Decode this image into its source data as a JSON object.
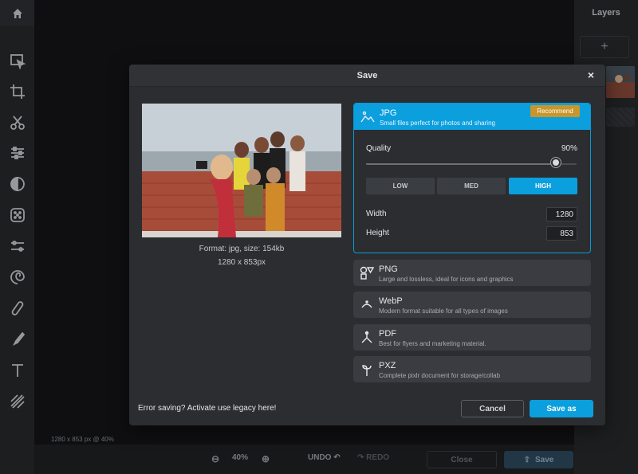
{
  "layers": {
    "title": "Layers",
    "add_label": "+"
  },
  "canvas": {
    "info": "1280 x 853 px @ 40%"
  },
  "bottombar": {
    "zoom": "40%",
    "undo": "UNDO",
    "redo": "REDO",
    "close": "Close",
    "save": "Save"
  },
  "toolbar": {
    "icons": [
      "home-icon",
      "arrange-icon",
      "crop-icon",
      "cutout-icon",
      "adjust-icon",
      "filter-icon",
      "effect-icon",
      "liquify-icon",
      "retouch-icon",
      "heal-icon",
      "draw-icon",
      "text-icon",
      "pattern-icon"
    ]
  },
  "modal": {
    "title": "Save",
    "close_label": "×",
    "preview": {
      "format": "Format: jpg, size: 154kb",
      "dimensions": "1280 x 853px"
    },
    "formats": [
      {
        "name": "JPG",
        "desc": "Small files perfect for photos and sharing",
        "badge": "Recommend",
        "selected": true
      },
      {
        "name": "PNG",
        "desc": "Large and lossless, ideal for icons and graphics"
      },
      {
        "name": "WebP",
        "desc": "Modern format suitable for all types of images"
      },
      {
        "name": "PDF",
        "desc": "Best for flyers and marketing material."
      },
      {
        "name": "PXZ",
        "desc": "Complete pixlr document for storage/collab"
      }
    ],
    "quality": {
      "label": "Quality",
      "value": "90%",
      "level": 0.9,
      "presets": [
        "LOW",
        "MED",
        "HIGH"
      ],
      "active_preset": "HIGH"
    },
    "width": {
      "label": "Width",
      "value": "1280"
    },
    "height": {
      "label": "Height",
      "value": "853"
    },
    "legacy_link": "Error saving? Activate use legacy here!",
    "cancel_label": "Cancel",
    "save_as_label": "Save as"
  },
  "colors": {
    "accent": "#0b9fde",
    "badge": "#c8962b",
    "panel": "#2b2d31"
  }
}
